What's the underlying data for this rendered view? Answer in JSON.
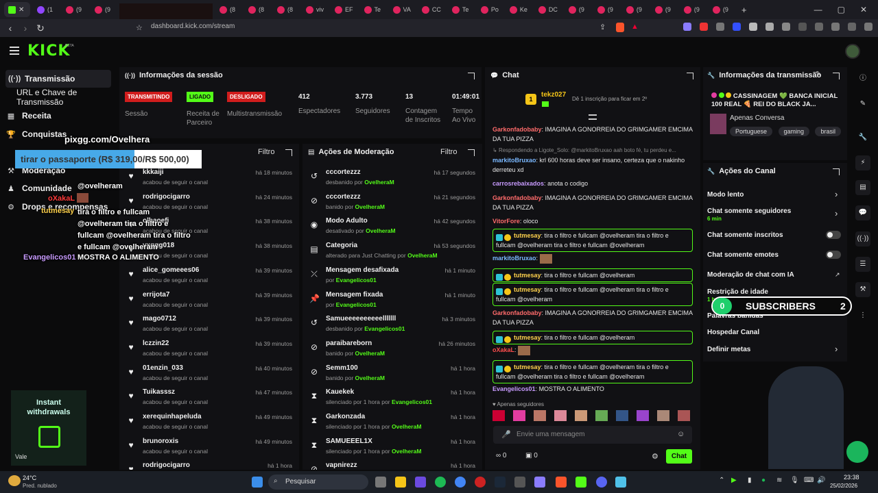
{
  "browser": {
    "tabs": [
      "(1",
      "(9",
      "(9",
      "(8",
      "(8",
      "(8",
      "viv",
      "EF",
      "Te",
      "VA",
      "CC",
      "Te",
      "Po",
      "Ke",
      "DC",
      "(9",
      "(9",
      "(9",
      "(9",
      "(9",
      "(9",
      "(9",
      "(9"
    ],
    "url": "dashboard.kick.com/stream"
  },
  "kick": {
    "logo": "KICK",
    "beta": "BETA"
  },
  "sidebar": {
    "items": [
      {
        "label": "Transmissão",
        "icon": "broadcast-icon"
      },
      {
        "label": "URL e Chave de Transmissão",
        "icon": "link-icon"
      },
      {
        "label": "Receita",
        "icon": "revenue-icon"
      },
      {
        "label": "Conquistas",
        "icon": "trophy-icon"
      },
      {
        "label": "Moderação",
        "icon": "moderation-icon"
      },
      {
        "label": "Comunidade",
        "icon": "community-icon"
      },
      {
        "label": "Drops e recompensas",
        "icon": "drops-icon"
      }
    ]
  },
  "session": {
    "title": "Informações da sessão",
    "badges": [
      {
        "label": "TRANSMITINDO",
        "caption": "Sessão",
        "color": "#e02424"
      },
      {
        "label": "LIGADO",
        "caption": "Receita de Parceiro",
        "color": "#53fc18"
      },
      {
        "label": "DESLIGADO",
        "caption": "Multistransmissão",
        "color": "#e02424"
      }
    ],
    "stats": [
      {
        "value": "412",
        "label": "Espectadores"
      },
      {
        "value": "3.773",
        "label": "Seguidores"
      },
      {
        "value": "13",
        "label": "Contagem de Inscritos"
      },
      {
        "value": "01:49:01",
        "label": "Tempo Ao Vivo"
      }
    ]
  },
  "activity": {
    "filter": "Filtro",
    "items": [
      {
        "name": "kkkaiji",
        "sub": "acabou de seguir o canal",
        "time": "há 18 minutos"
      },
      {
        "name": "rodrigocigarro",
        "sub": "acabou de seguir o canal",
        "time": "há 24 minutos"
      },
      {
        "name": "olhaoefi",
        "sub": "acabou de seguir o canal",
        "time": "há 38 minutos"
      },
      {
        "name": "vxggg018",
        "sub": "acabou de seguir o canal",
        "time": "há 38 minutos"
      },
      {
        "name": "alice_gomeees06",
        "sub": "acabou de seguir o canal",
        "time": "há 39 minutos"
      },
      {
        "name": "errijota7",
        "sub": "acabou de seguir o canal",
        "time": "há 39 minutos"
      },
      {
        "name": "mago0712",
        "sub": "acabou de seguir o canal",
        "time": "há 39 minutos"
      },
      {
        "name": "lczzin22",
        "sub": "acabou de seguir o canal",
        "time": "há 39 minutos"
      },
      {
        "name": "01enzin_033",
        "sub": "acabou de seguir o canal",
        "time": "há 40 minutos"
      },
      {
        "name": "Tuikasssz",
        "sub": "acabou de seguir o canal",
        "time": "há 47 minutos"
      },
      {
        "name": "xerequinhapeluda",
        "sub": "acabou de seguir o canal",
        "time": "há 49 minutos"
      },
      {
        "name": "brunoroxis",
        "sub": "acabou de seguir o canal",
        "time": "há 49 minutos"
      },
      {
        "name": "rodrigocigarro",
        "sub": "",
        "time": "há 1 hora"
      }
    ]
  },
  "moderation": {
    "title": "Ações de Moderação",
    "filter": "Filtro",
    "items": [
      {
        "icon": "unban-icon",
        "name": "cccortezzz",
        "sub": "desbanido por",
        "by": "OvelheraM",
        "time": "há 17 segundos"
      },
      {
        "icon": "ban-icon",
        "name": "cccortezzz",
        "sub": "banido por",
        "by": "OvelheraM",
        "time": "há 21 segundos"
      },
      {
        "icon": "eye-icon",
        "name": "Modo Adulto",
        "sub": "desativado por",
        "by": "OvelheraM",
        "time": "há 42 segundos"
      },
      {
        "icon": "category-icon",
        "name": "Categoria",
        "sub": "alterado para Just Chatting por",
        "by": "OvelheraM",
        "time": "há 53 segundos"
      },
      {
        "icon": "unpin-icon",
        "name": "Mensagem desafixada",
        "sub": "por",
        "by": "Evangelicos01",
        "time": "há 1 minuto"
      },
      {
        "icon": "pin-icon",
        "name": "Mensagem fixada",
        "sub": "por",
        "by": "Evangelicos01",
        "time": "há 1 minuto"
      },
      {
        "icon": "unban-icon",
        "name": "Samueeeeeeeeeelllllll",
        "sub": "desbanido por",
        "by": "Evangelicos01",
        "time": "há 3 minutos"
      },
      {
        "icon": "ban-icon",
        "name": "paraibareborn",
        "sub": "banido por",
        "by": "OvelheraM",
        "time": "há 26 minutos"
      },
      {
        "icon": "ban-icon",
        "name": "Semm100",
        "sub": "banido por",
        "by": "OvelheraM",
        "time": "há 1 hora"
      },
      {
        "icon": "hourglass-icon",
        "name": "Kauekek",
        "sub": "silenciado por 1 hora por",
        "by": "Evangelicos01",
        "time": "há 1 hora"
      },
      {
        "icon": "hourglass-icon",
        "name": "Garkonzada",
        "sub": "silenciado por 1 hora por",
        "by": "OvelheraM",
        "time": "há 1 hora"
      },
      {
        "icon": "hourglass-icon",
        "name": "SAMUEEEL1X",
        "sub": "silenciado por 1 hora por",
        "by": "OvelheraM",
        "time": "há 1 hora"
      },
      {
        "icon": "ban-icon",
        "name": "vapnirezz",
        "sub": "",
        "by": "",
        "time": "há 1 hora"
      }
    ]
  },
  "chat": {
    "title": "Chat",
    "pinned_user": "tekz027",
    "pinned_note": "Dê 1 inscrição para ficar em 2º",
    "messages": [
      {
        "user": "Garkonfadobaby",
        "color": "#ff6b6b",
        "text": "IMAGINA A GONORREIA DO GRIMGAMER EMCIMA DA TUA PIZZA",
        "boxed": false
      },
      {
        "user": "",
        "color": "#9a9a9a",
        "text": "Respondendo a Ligote_Solo: @markitoBruxao aah boto fé, tu perdeu e...",
        "boxed": false,
        "reply": true
      },
      {
        "user": "markitoBruxao",
        "color": "#7ab8ff",
        "text": "krl 600 horas deve ser insano, certeza que o nakinho derreteu xd",
        "boxed": false
      },
      {
        "user": "carrosrebaixados",
        "color": "#c89bff",
        "text": "anota o codigo",
        "boxed": false
      },
      {
        "user": "Garkonfadobaby",
        "color": "#ff6b6b",
        "text": "IMAGINA A GONORREIA DO GRIMGAMER EMCIMA DA TUA PIZZA",
        "boxed": false
      },
      {
        "user": "VitorFore",
        "color": "#ff6b6b",
        "text": "oloco",
        "boxed": false
      },
      {
        "user": "tutmesay",
        "color": "#ffd24d",
        "text": "tira o filtro e fullcam @ovelheram tira o filtro e fullcam @ovelheram tira o filtro e fullcam @ovelheram",
        "boxed": true
      },
      {
        "user": "markitoBruxao",
        "color": "#7ab8ff",
        "text": "",
        "boxed": false
      },
      {
        "user": "tutmesay",
        "color": "#ffd24d",
        "text": "tira o filtro e fullcam @ovelheram",
        "boxed": true
      },
      {
        "user": "tutmesay",
        "color": "#ffd24d",
        "text": "tira o filtro e fullcam @ovelheram tira o filtro e fullcam @ovelheram",
        "boxed": true
      },
      {
        "user": "Garkonfadobaby",
        "color": "#ff6b6b",
        "text": "IMAGINA A GONORREIA DO GRIMGAMER EMCIMA DA TUA PIZZA",
        "boxed": false
      },
      {
        "user": "tutmesay",
        "color": "#ffd24d",
        "text": "tira o filtro e fullcam @ovelheram",
        "boxed": true
      },
      {
        "user": "oXakaL",
        "color": "#ff4d4d",
        "text": "",
        "boxed": false
      },
      {
        "user": "tutmesay",
        "color": "#ffd24d",
        "text": "tira o filtro e fullcam @ovelheram tira o filtro e fullcam @ovelheram tira o filtro e fullcam @ovelheram",
        "boxed": true
      },
      {
        "user": "Evangelicos01",
        "color": "#c89bff",
        "text": "MOSTRA O ALIMENTO",
        "boxed": false
      }
    ],
    "followers_only": "Apenas seguidores",
    "input_placeholder": "Envie uma mensagem",
    "infinity_count": "0",
    "gift_count": "0",
    "send_label": "Chat"
  },
  "stream_info": {
    "title": "Informações da transmissão",
    "stream_title": "CASSINAGEM 💚 BANCA INICIAL 100 REAL 🍕 REI DO BLACK JA...",
    "category": "Apenas Conversa",
    "tags": [
      "Portuguese",
      "gaming",
      "brasil"
    ]
  },
  "channel_actions": {
    "title": "Ações do Canal",
    "items": [
      {
        "label": "Modo lento",
        "sub": "",
        "control": "chevron"
      },
      {
        "label": "Chat somente seguidores",
        "sub": "6 min",
        "control": "chevron"
      },
      {
        "label": "Chat somente inscritos",
        "sub": "",
        "control": "toggle"
      },
      {
        "label": "Chat somente emotes",
        "sub": "",
        "control": "toggle"
      },
      {
        "label": "Moderação de chat com IA",
        "sub": "",
        "control": "external"
      },
      {
        "label": "Restrição de idade",
        "sub": "1 h",
        "control": "chevron"
      },
      {
        "label": "Palavras banidas",
        "sub": "",
        "control": "chevron"
      },
      {
        "label": "Hospedar Canal",
        "sub": "",
        "control": "none"
      },
      {
        "label": "Definir metas",
        "sub": "",
        "control": "chevron"
      }
    ]
  },
  "overlays": {
    "pixgg": "pixgg.com/Ovelhera",
    "goal": "tirar o passaporte (R$ 319,00/R$ 500,00)",
    "subs_left": "0",
    "subs_label": "SUBSCRIBERS",
    "subs_right": "2",
    "ad_line1": "Instant",
    "ad_line2": "withdrawals",
    "ad_vale": "Vale",
    "ov_chat": [
      {
        "user": "",
        "text": "@ovelheram"
      },
      {
        "user": "oXakaL",
        "text": ""
      },
      {
        "user": "tutmesay",
        "text": "tira o filtro e fullcam @ovelheram tira o filtro e fullcam @ovelheram tira o filtro e fullcam @ovelheram"
      },
      {
        "user": "Evangelicos01",
        "text": "MOSTRA O ALIMENTO"
      }
    ]
  },
  "taskbar": {
    "weather_temp": "24°C",
    "weather_desc": "Pred. nublado",
    "search": "Pesquisar",
    "time": "23:38",
    "date": "25/02/2026"
  }
}
